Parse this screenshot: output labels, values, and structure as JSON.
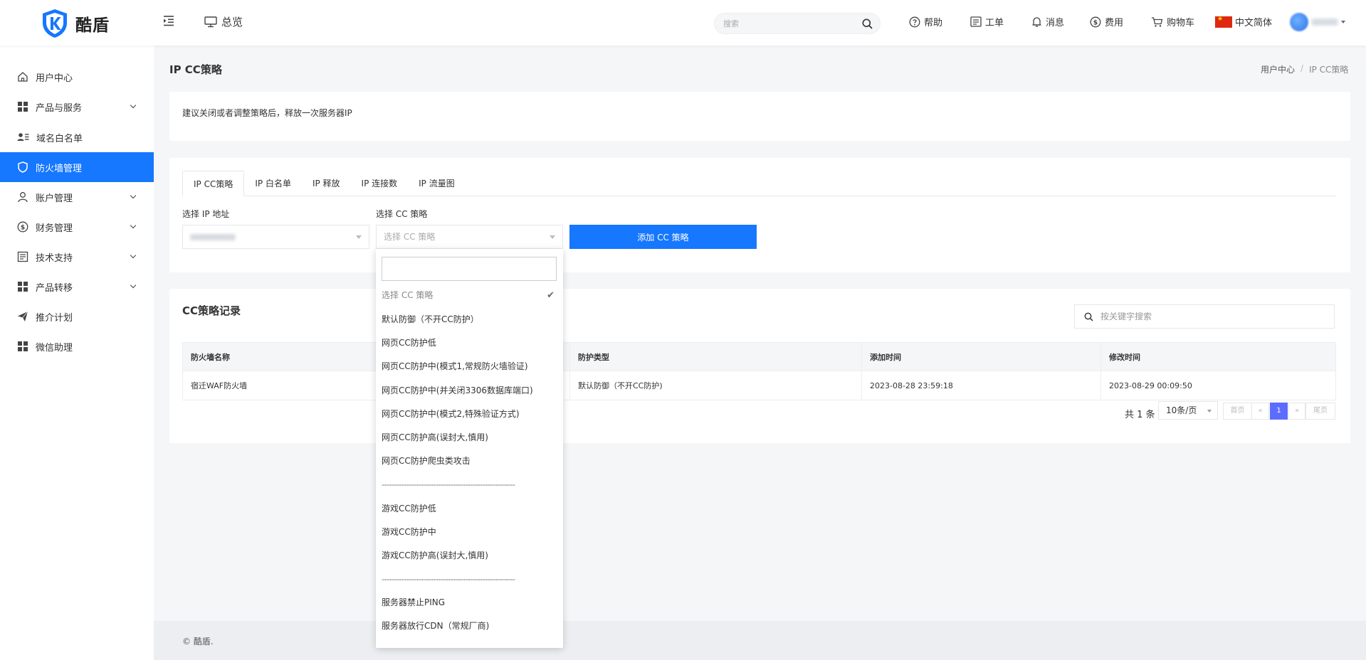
{
  "header": {
    "logo_text": "酷盾",
    "overview_label": "总览",
    "search_placeholder": "搜索",
    "nav": {
      "help": "帮助",
      "ticket": "工单",
      "messages": "消息",
      "billing": "费用",
      "cart": "购物车",
      "language": "中文简体"
    }
  },
  "sidebar": {
    "items": [
      {
        "label": "用户中心",
        "icon": "home-icon",
        "expandable": false
      },
      {
        "label": "产品与服务",
        "icon": "grid-icon",
        "expandable": true
      },
      {
        "label": "域名白名单",
        "icon": "user-list-icon",
        "expandable": false
      },
      {
        "label": "防火墙管理",
        "icon": "shield-icon",
        "expandable": false,
        "active": true
      },
      {
        "label": "账户管理",
        "icon": "user-icon",
        "expandable": true
      },
      {
        "label": "财务管理",
        "icon": "dollar-icon",
        "expandable": true
      },
      {
        "label": "技术支持",
        "icon": "document-icon",
        "expandable": true
      },
      {
        "label": "产品转移",
        "icon": "grid-icon",
        "expandable": true
      },
      {
        "label": "推介计划",
        "icon": "send-icon",
        "expandable": false
      },
      {
        "label": "微信助理",
        "icon": "grid-icon",
        "expandable": false
      }
    ]
  },
  "page": {
    "title": "IP CC策略",
    "breadcrumb": [
      "用户中心",
      "IP CC策略"
    ],
    "notice": "建议关闭或者调整策略后，释放一次服务器IP"
  },
  "tabs": [
    "IP CC策略",
    "IP 白名单",
    "IP 释放",
    "IP 连接数",
    "IP 流量图"
  ],
  "form": {
    "ip_label": "选择 IP 地址",
    "cc_label": "选择 CC 策略",
    "cc_placeholder": "选择 CC 策略",
    "add_button": "添加 CC 策略"
  },
  "dropdown": {
    "options": [
      {
        "label": "选择 CC 策略",
        "selected": true
      },
      {
        "label": "默认防御（不开CC防护）"
      },
      {
        "label": "网页CC防护低"
      },
      {
        "label": "网页CC防护中(模式1,常规防火墙验证)"
      },
      {
        "label": "网页CC防护中(并关闭3306数据库端口)"
      },
      {
        "label": "网页CC防护中(模式2,特殊验证方式)"
      },
      {
        "label": "网页CC防护高(误封大,慎用)"
      },
      {
        "label": "网页CC防护爬虫类攻击"
      },
      {
        "label": "------------------------------------------------------",
        "separator": true
      },
      {
        "label": "游戏CC防护低"
      },
      {
        "label": "游戏CC防护中"
      },
      {
        "label": "游戏CC防护高(误封大,慎用)"
      },
      {
        "label": "------------------------------------------------------",
        "separator": true
      },
      {
        "label": "服务器禁止PING"
      },
      {
        "label": "服务器放行CDN（常规厂商)"
      }
    ]
  },
  "records": {
    "title": "CC策略记录",
    "search_placeholder": "按关键字搜索",
    "columns": [
      "防火墙名称",
      "",
      "防护类型",
      "添加时间",
      "修改时间"
    ],
    "rows": [
      [
        "宿迁WAF防火墙",
        "",
        "默认防御（不开CC防护)",
        "2023-08-28 23:59:18",
        "2023-08-29 00:09:50"
      ]
    ],
    "total": "共 1 条",
    "page_size": "10条/页",
    "pager": {
      "first": "首页",
      "prev": "«",
      "current": "1",
      "next": "»",
      "last": "尾页"
    }
  },
  "footer": {
    "copyright": "© 酷盾."
  },
  "colors": {
    "primary": "#1677ff",
    "pager_active": "#5b6cff"
  }
}
